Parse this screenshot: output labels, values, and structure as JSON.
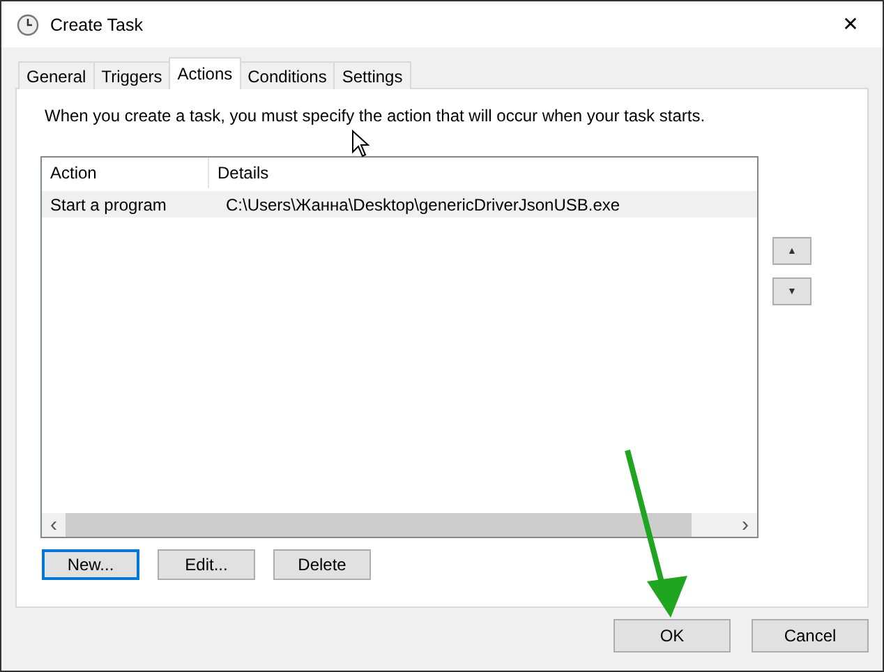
{
  "window": {
    "title": "Create Task",
    "close": "✕"
  },
  "tabs": [
    {
      "label": "General",
      "selected": false
    },
    {
      "label": "Triggers",
      "selected": false
    },
    {
      "label": "Actions",
      "selected": true
    },
    {
      "label": "Conditions",
      "selected": false
    },
    {
      "label": "Settings",
      "selected": false
    }
  ],
  "description": "When you create a task, you must specify the action that will occur when your task starts.",
  "table": {
    "columns": [
      "Action",
      "Details"
    ],
    "rows": [
      {
        "cells": [
          "Start a program",
          "C:\\Users\\Жанна\\Desktop\\genericDriverJsonUSB.exe"
        ],
        "selected": true
      }
    ]
  },
  "scroll_left": "‹",
  "scroll_right": "›",
  "move_buttons": [
    "▲",
    "▼"
  ],
  "action_buttons": [
    {
      "label": "New...",
      "focused": true
    },
    {
      "label": "Edit...",
      "focused": false
    },
    {
      "label": "Delete",
      "focused": false
    }
  ],
  "dialog_buttons": [
    "OK",
    "Cancel"
  ]
}
